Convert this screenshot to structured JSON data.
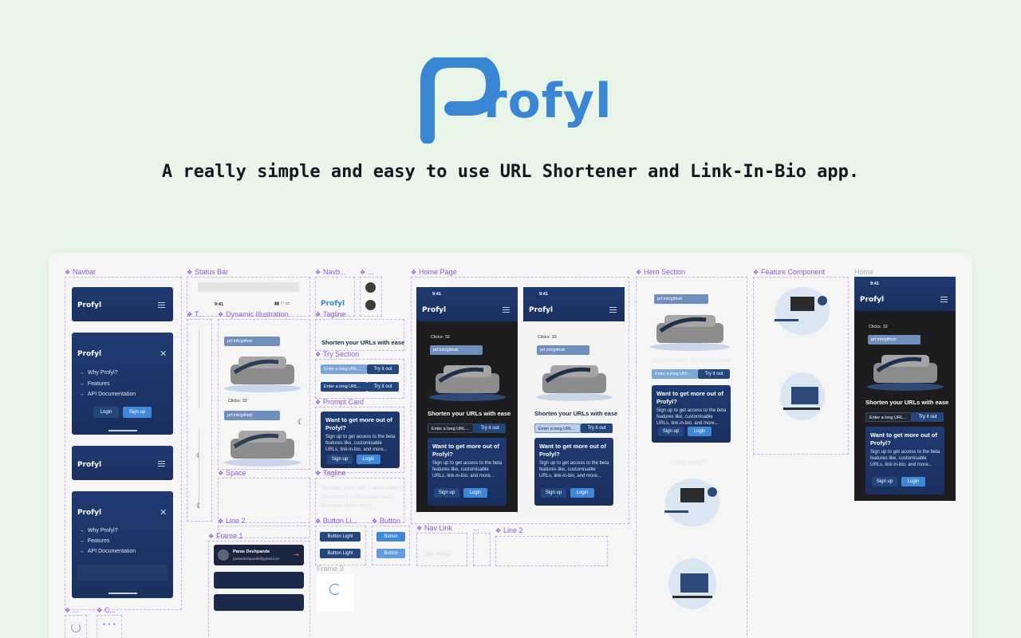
{
  "header": {
    "brand": "rofyl",
    "tagline": "A really simple and easy to use URL Shortener and Link-In-Bio app."
  },
  "colors": {
    "brand_blue": "#3a86d4",
    "navy": "#1f3a72",
    "dark": "#1d1d1f",
    "page_bg": "#e9f5e9",
    "label_purple": "#8e59d8"
  },
  "labels": {
    "navbar": "Navbar",
    "status_bar": "Status Bar",
    "navb": "Navb...",
    "dots": "...",
    "home_page": "Home Page",
    "hero_section": "Hero Section",
    "feature_component": "Feature Component",
    "home": "Home",
    "t": "T...",
    "dynamic_illustration": "Dynamic Illustration",
    "tagline": "Tagline",
    "try_section": "Try Section",
    "prompt_card": "Prompt Card",
    "space": "Space",
    "tagline2": "Tagline",
    "line2": "Line 2",
    "frame1": "Frame 1",
    "button_li": "Button Li...",
    "button": "Button",
    "nav_link": "Nav Link",
    "dots2": "...",
    "line2b": "Line 2",
    "frame3": "Frame 3",
    "c": "C..."
  },
  "app": {
    "logo": "Profyl",
    "menu": [
      "Why Profyl?",
      "Features",
      "API Documentation"
    ],
    "login": "Login",
    "signup": "Sign up",
    "time": "9:41",
    "link": "prf.ink/github",
    "clicks": "Clicks: 32",
    "clicks_sub": "(last 24 hours)",
    "hero_tagline": "Shorten your URLs with ease",
    "input_placeholder": "Enter a long URL...",
    "try_it_out": "Try it out",
    "prompt_title": "Want to get more out of Profyl?",
    "prompt_body": "Sign up to get access to the beta features like, customisable URLs, link-in-bio, and more...",
    "tagline_long": "Shorten your URLs with ease, Shortened links made easy, Designs done easy",
    "profile_name": "Paras Deshpande",
    "profile_email": "parasdeshpande@gmail.com",
    "button_light": "Button Light",
    "button": "Button",
    "nav_link": "URL Profyl",
    "why_profyl": "Why profyl?"
  }
}
